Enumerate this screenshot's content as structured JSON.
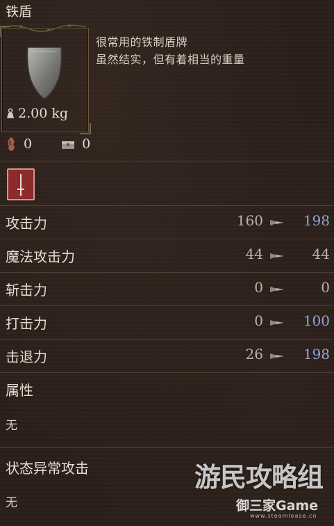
{
  "item": {
    "name": "铁盾",
    "weight": "2.00 kg",
    "description": [
      "很常用的铁制盾牌",
      "虽然结实，但有着相当的重量"
    ]
  },
  "costs": [
    {
      "icon": "stamina-icon",
      "value": "0"
    },
    {
      "icon": "chest-icon",
      "value": "0"
    }
  ],
  "type_icon": "sword-badge-icon",
  "stats": [
    {
      "label": "攻击力",
      "base": "160",
      "new": "198",
      "new_color": "#8fa6d8"
    },
    {
      "label": "魔法攻击力",
      "base": "44",
      "new": "44",
      "new_color": "#bcb4a8"
    },
    {
      "label": "斩击力",
      "base": "0",
      "new": "0",
      "new_color": "#bcb4a8"
    },
    {
      "label": "打击力",
      "base": "0",
      "new": "100",
      "new_color": "#8fa6d8"
    },
    {
      "label": "击退力",
      "base": "26",
      "new": "198",
      "new_color": "#8fa6d8"
    }
  ],
  "attribute": {
    "label": "属性",
    "value": "无"
  },
  "status_attack": {
    "label": "状态异常攻击",
    "value": "无"
  },
  "watermark": {
    "main": "游民攻略组",
    "sub": "御三家Game",
    "url": "www.steamlease.cn"
  }
}
